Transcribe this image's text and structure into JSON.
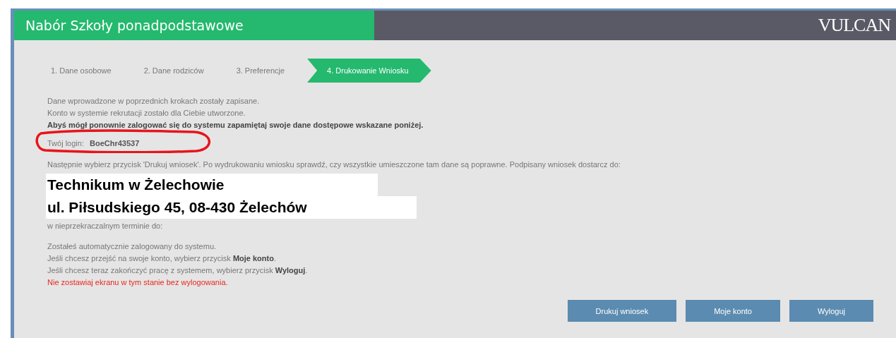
{
  "header": {
    "title": "Nabór Szkoły ponadpodstawowe",
    "logo": "VULCAN"
  },
  "steps": [
    {
      "label": "1. Dane osobowe",
      "selected": false
    },
    {
      "label": "2. Dane rodziców",
      "selected": false
    },
    {
      "label": "3. Preferencje",
      "selected": false
    },
    {
      "label": "4. Drukowanie Wniosku",
      "selected": true
    }
  ],
  "messages": [
    {
      "text": "Dane wprowadzone w poprzednich krokach zostały zapisane.",
      "kind": "normal"
    },
    {
      "text": "Konto w systemie rekrutacji zostało dla Ciebie utworzone.",
      "kind": "normal"
    },
    {
      "text": "Abyś mógł ponownie zalogować się do systemu zapamiętaj swoje dane dostępowe wskazane poniżej.",
      "kind": "bold"
    }
  ],
  "login": {
    "label": "Twój login:",
    "value": "BoeChr43537",
    "circled": true
  },
  "instructions": "Następnie wybierz przycisk 'Drukuj wniosek'. Po wydrukowaniu wniosku sprawdź, czy wszystkie umieszczone tam dane są poprawne. Podpisany wniosek dostarcz do:",
  "address_lines": [
    "Technikum w Żelechowie",
    "ul. Piłsudskiego 45, 08-430 Żelechów"
  ],
  "deadline": "w nieprzekraczalnym terminie do:",
  "info_lines": [
    {
      "text": "Zostałeś automatycznie zalogowany do systemu.",
      "kind": "normal"
    },
    {
      "text": "Jeśli chcesz przejść na swoje konto, wybierz przycisk **Moje konto**.",
      "kind": "normal"
    },
    {
      "text": "Jeśli chcesz teraz zakończyć pracę z systemem, wybierz przycisk **Wyloguj**.",
      "kind": "normal"
    },
    {
      "text": "Nie zostawiaj ekranu w tym stanie bez wylogowania.",
      "kind": "warning"
    }
  ],
  "buttons": [
    "Drukuj wniosek",
    "Moje konto",
    "Wyloguj"
  ]
}
